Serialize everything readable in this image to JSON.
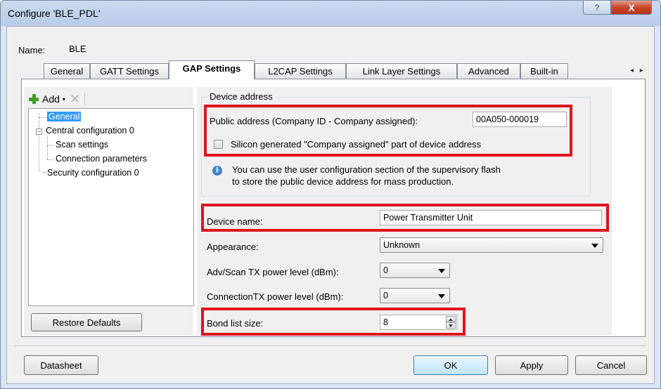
{
  "window": {
    "title": "Configure 'BLE_PDL'",
    "help_glyph": "?",
    "close_glyph": "X"
  },
  "name": {
    "label": "Name:",
    "value": "BLE"
  },
  "tabs": [
    {
      "label": "General"
    },
    {
      "label": "GATT Settings"
    },
    {
      "label": "GAP Settings",
      "active": true
    },
    {
      "label": "L2CAP Settings"
    },
    {
      "label": "Link Layer Settings"
    },
    {
      "label": "Advanced"
    },
    {
      "label": "Built-in"
    }
  ],
  "tab_scroll": "◂ ▸",
  "toolbar": {
    "add_label": "Add",
    "caret": "▾",
    "delete_glyph": "✕"
  },
  "tree": {
    "general": "General",
    "central": "Central configuration 0",
    "scan": "Scan settings",
    "connection": "Connection parameters",
    "security": "Security configuration 0"
  },
  "restore_defaults": "Restore Defaults",
  "device_address": {
    "group_title": "Device address",
    "public_label": "Public address (Company ID - Company assigned):",
    "public_value": "00A050-000019",
    "silicon_label": "Silicon generated \"Company assigned\" part of device address",
    "info_line1": "You can use the user configuration section of the supervisory flash",
    "info_line2": "to store the public device address for mass production."
  },
  "device_name": {
    "label": "Device name:",
    "value": "Power Transmitter Unit"
  },
  "appearance": {
    "label": "Appearance:",
    "value": "Unknown"
  },
  "adv_tx": {
    "label": "Adv/Scan TX power level (dBm):",
    "value": "0"
  },
  "conn_tx": {
    "label": "ConnectionTX power level (dBm):",
    "value": "0"
  },
  "bond_list": {
    "label": "Bond list size:",
    "value": "8"
  },
  "buttons": {
    "datasheet": "Datasheet",
    "ok": "OK",
    "apply": "Apply",
    "cancel": "Cancel"
  },
  "colors": {
    "highlight": "#e0141e",
    "selection": "#3399ff",
    "close_button": "#c9452c"
  }
}
